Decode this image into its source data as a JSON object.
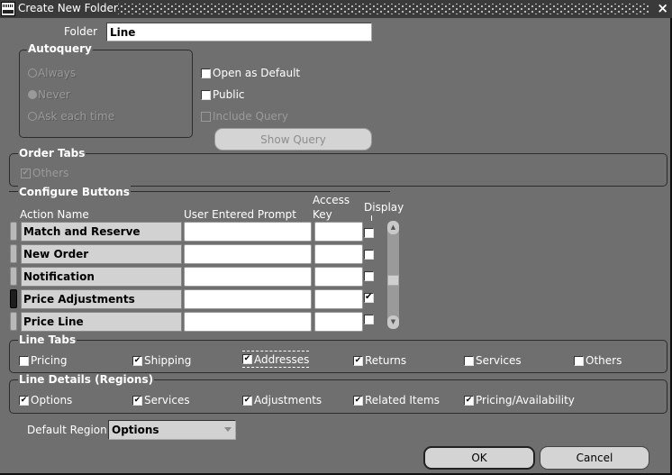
{
  "window": {
    "title": "Create New Folder",
    "close_icon": "×"
  },
  "folder": {
    "label": "Folder",
    "value": "Line"
  },
  "autoquery": {
    "title": "Autoquery",
    "options": [
      {
        "label": "Always",
        "selected": false
      },
      {
        "label": "Never",
        "selected": true
      },
      {
        "label": "Ask each time",
        "selected": false
      }
    ]
  },
  "options": {
    "open_as_default": {
      "label": "Open as Default",
      "checked": false
    },
    "public": {
      "label": "Public",
      "checked": false
    },
    "include_query": {
      "label": "Include Query",
      "checked": false,
      "disabled": true
    },
    "show_query_button": "Show Query"
  },
  "order_tabs": {
    "title": "Order Tabs",
    "items": [
      {
        "label": "Others",
        "checked": true,
        "disabled": true
      }
    ]
  },
  "configure_buttons": {
    "title": "Configure Buttons",
    "columns": {
      "action_name": "Action Name",
      "prompt": "User Entered Prompt",
      "access_key_1": "Access",
      "access_key_2": "Key",
      "display": "Display"
    },
    "rows": [
      {
        "action": "Match and Reserve",
        "prompt": "",
        "access_key": "",
        "display": false,
        "current": false
      },
      {
        "action": "New Order",
        "prompt": "",
        "access_key": "",
        "display": false,
        "current": false
      },
      {
        "action": "Notification",
        "prompt": "",
        "access_key": "",
        "display": false,
        "current": false
      },
      {
        "action": "Price Adjustments",
        "prompt": "",
        "access_key": "",
        "display": true,
        "current": true
      },
      {
        "action": "Price Line",
        "prompt": "",
        "access_key": "",
        "display": false,
        "current": false
      }
    ]
  },
  "line_tabs": {
    "title": "Line Tabs",
    "items": [
      {
        "label": "Pricing",
        "checked": false
      },
      {
        "label": "Shipping",
        "checked": true
      },
      {
        "label": "Addresses",
        "checked": true,
        "focused": true
      },
      {
        "label": "Returns",
        "checked": true
      },
      {
        "label": "Services",
        "checked": false
      },
      {
        "label": "Others",
        "checked": false
      }
    ]
  },
  "line_details": {
    "title": "Line Details (Regions)",
    "items": [
      {
        "label": "Options",
        "checked": true
      },
      {
        "label": "Services",
        "checked": true
      },
      {
        "label": "Adjustments",
        "checked": true
      },
      {
        "label": "Related Items",
        "checked": true
      },
      {
        "label": "Pricing/Availability",
        "checked": true
      }
    ]
  },
  "default_region": {
    "label": "Default Region",
    "value": "Options"
  },
  "buttons": {
    "ok": "OK",
    "cancel": "Cancel"
  }
}
